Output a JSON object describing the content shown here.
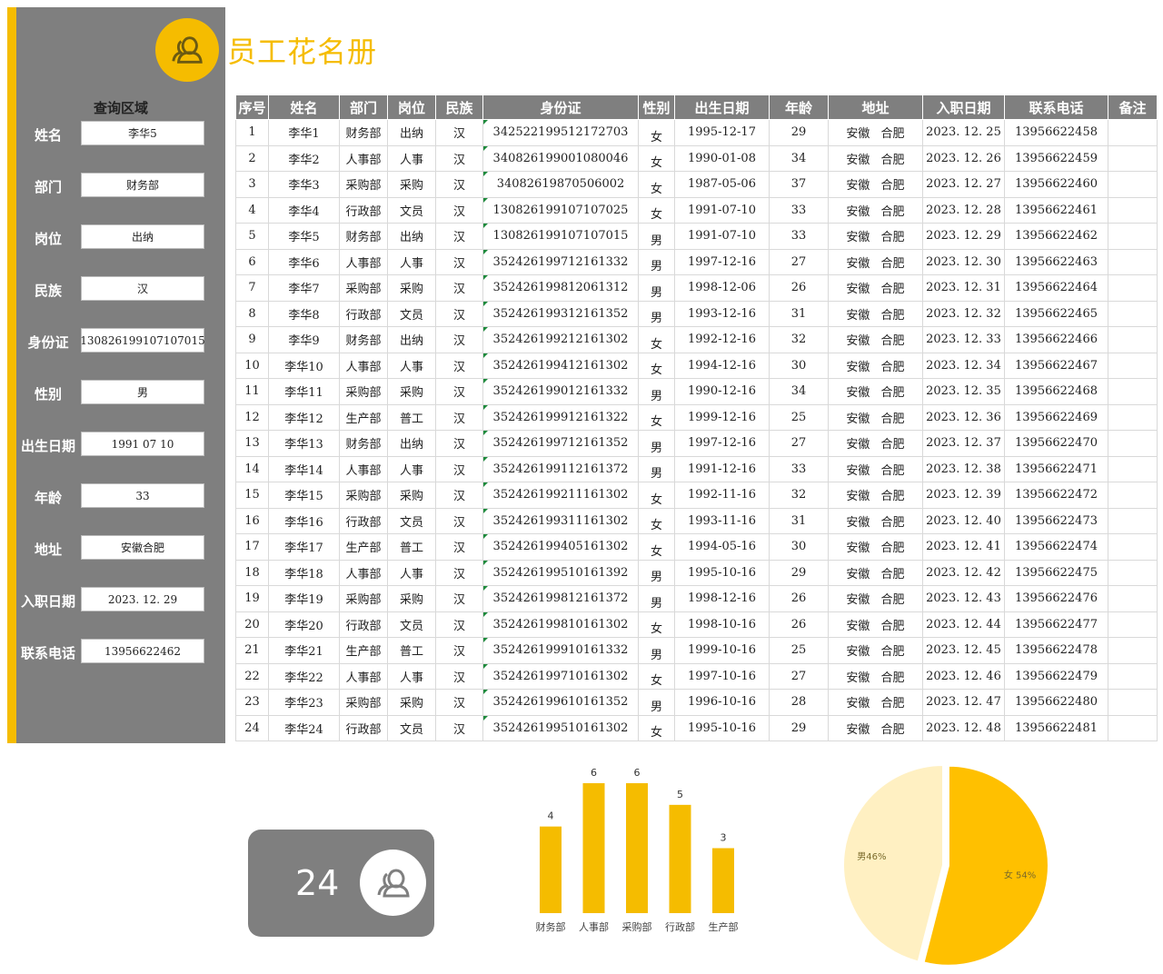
{
  "app": {
    "title": "员工花名册"
  },
  "query": {
    "title": "查询区域",
    "fields": [
      {
        "label": "姓名",
        "value": "李华5"
      },
      {
        "label": "部门",
        "value": "财务部"
      },
      {
        "label": "岗位",
        "value": "出纳"
      },
      {
        "label": "民族",
        "value": "汉"
      },
      {
        "label": "身份证",
        "value": "130826199107107015"
      },
      {
        "label": "性别",
        "value": "男"
      },
      {
        "label": "出生日期",
        "value": "1991  07  10"
      },
      {
        "label": "年龄",
        "value": "33"
      },
      {
        "label": "地址",
        "value": "安徽合肥"
      },
      {
        "label": "入职日期",
        "value": "2023. 12. 29"
      },
      {
        "label": "联系电话",
        "value": "13956622462"
      }
    ]
  },
  "table": {
    "columns": [
      "序号",
      "姓名",
      "部门",
      "岗位",
      "民族",
      "身份证",
      "性别",
      "出生日期",
      "年龄",
      "地址",
      "入职日期",
      "联系电话",
      "备注"
    ],
    "rows": [
      [
        "1",
        "李华1",
        "财务部",
        "出纳",
        "汉",
        "342522199512172703",
        "女",
        "1995-12-17",
        "29",
        "安徽 合肥",
        "2023. 12. 25",
        "13956622458",
        ""
      ],
      [
        "2",
        "李华2",
        "人事部",
        "人事",
        "汉",
        "340826199001080046",
        "女",
        "1990-01-08",
        "34",
        "安徽 合肥",
        "2023. 12. 26",
        "13956622459",
        ""
      ],
      [
        "3",
        "李华3",
        "采购部",
        "采购",
        "汉",
        "34082619870506002",
        "女",
        "1987-05-06",
        "37",
        "安徽 合肥",
        "2023. 12. 27",
        "13956622460",
        ""
      ],
      [
        "4",
        "李华4",
        "行政部",
        "文员",
        "汉",
        "130826199107107025",
        "女",
        "1991-07-10",
        "33",
        "安徽 合肥",
        "2023. 12. 28",
        "13956622461",
        ""
      ],
      [
        "5",
        "李华5",
        "财务部",
        "出纳",
        "汉",
        "130826199107107015",
        "男",
        "1991-07-10",
        "33",
        "安徽 合肥",
        "2023. 12. 29",
        "13956622462",
        ""
      ],
      [
        "6",
        "李华6",
        "人事部",
        "人事",
        "汉",
        "352426199712161332",
        "男",
        "1997-12-16",
        "27",
        "安徽 合肥",
        "2023. 12. 30",
        "13956622463",
        ""
      ],
      [
        "7",
        "李华7",
        "采购部",
        "采购",
        "汉",
        "352426199812061312",
        "男",
        "1998-12-06",
        "26",
        "安徽 合肥",
        "2023. 12. 31",
        "13956622464",
        ""
      ],
      [
        "8",
        "李华8",
        "行政部",
        "文员",
        "汉",
        "352426199312161352",
        "男",
        "1993-12-16",
        "31",
        "安徽 合肥",
        "2023. 12. 32",
        "13956622465",
        ""
      ],
      [
        "9",
        "李华9",
        "财务部",
        "出纳",
        "汉",
        "352426199212161302",
        "女",
        "1992-12-16",
        "32",
        "安徽 合肥",
        "2023. 12. 33",
        "13956622466",
        ""
      ],
      [
        "10",
        "李华10",
        "人事部",
        "人事",
        "汉",
        "352426199412161302",
        "女",
        "1994-12-16",
        "30",
        "安徽 合肥",
        "2023. 12. 34",
        "13956622467",
        ""
      ],
      [
        "11",
        "李华11",
        "采购部",
        "采购",
        "汉",
        "352426199012161332",
        "男",
        "1990-12-16",
        "34",
        "安徽 合肥",
        "2023. 12. 35",
        "13956622468",
        ""
      ],
      [
        "12",
        "李华12",
        "生产部",
        "普工",
        "汉",
        "352426199912161322",
        "女",
        "1999-12-16",
        "25",
        "安徽 合肥",
        "2023. 12. 36",
        "13956622469",
        ""
      ],
      [
        "13",
        "李华13",
        "财务部",
        "出纳",
        "汉",
        "352426199712161352",
        "男",
        "1997-12-16",
        "27",
        "安徽 合肥",
        "2023. 12. 37",
        "13956622470",
        ""
      ],
      [
        "14",
        "李华14",
        "人事部",
        "人事",
        "汉",
        "352426199112161372",
        "男",
        "1991-12-16",
        "33",
        "安徽 合肥",
        "2023. 12. 38",
        "13956622471",
        ""
      ],
      [
        "15",
        "李华15",
        "采购部",
        "采购",
        "汉",
        "352426199211161302",
        "女",
        "1992-11-16",
        "32",
        "安徽 合肥",
        "2023. 12. 39",
        "13956622472",
        ""
      ],
      [
        "16",
        "李华16",
        "行政部",
        "文员",
        "汉",
        "352426199311161302",
        "女",
        "1993-11-16",
        "31",
        "安徽 合肥",
        "2023. 12. 40",
        "13956622473",
        ""
      ],
      [
        "17",
        "李华17",
        "生产部",
        "普工",
        "汉",
        "352426199405161302",
        "女",
        "1994-05-16",
        "30",
        "安徽 合肥",
        "2023. 12. 41",
        "13956622474",
        ""
      ],
      [
        "18",
        "李华18",
        "人事部",
        "人事",
        "汉",
        "352426199510161392",
        "男",
        "1995-10-16",
        "29",
        "安徽 合肥",
        "2023. 12. 42",
        "13956622475",
        ""
      ],
      [
        "19",
        "李华19",
        "采购部",
        "采购",
        "汉",
        "352426199812161372",
        "男",
        "1998-12-16",
        "26",
        "安徽 合肥",
        "2023. 12. 43",
        "13956622476",
        ""
      ],
      [
        "20",
        "李华20",
        "行政部",
        "文员",
        "汉",
        "352426199810161302",
        "女",
        "1998-10-16",
        "26",
        "安徽 合肥",
        "2023. 12. 44",
        "13956622477",
        ""
      ],
      [
        "21",
        "李华21",
        "生产部",
        "普工",
        "汉",
        "352426199910161332",
        "男",
        "1999-10-16",
        "25",
        "安徽 合肥",
        "2023. 12. 45",
        "13956622478",
        ""
      ],
      [
        "22",
        "李华22",
        "人事部",
        "人事",
        "汉",
        "352426199710161302",
        "女",
        "1997-10-16",
        "27",
        "安徽 合肥",
        "2023. 12. 46",
        "13956622479",
        ""
      ],
      [
        "23",
        "李华23",
        "采购部",
        "采购",
        "汉",
        "352426199610161352",
        "男",
        "1996-10-16",
        "28",
        "安徽 合肥",
        "2023. 12. 47",
        "13956622480",
        ""
      ],
      [
        "24",
        "李华24",
        "行政部",
        "文员",
        "汉",
        "352426199510161302",
        "女",
        "1995-10-16",
        "29",
        "安徽 合肥",
        "2023. 12. 48",
        "13956622481",
        ""
      ]
    ]
  },
  "summary": {
    "total": "24"
  },
  "colors": {
    "accent": "#f5bc00",
    "panel": "#7f7f7f",
    "pie_male": "#fff0c2",
    "pie_female": "#ffc000"
  },
  "icons": {
    "title_avatar": "user-avatar-icon",
    "total_avatar": "user-avatar-icon"
  },
  "chart_data": [
    {
      "type": "bar",
      "title": "",
      "categories": [
        "财务部",
        "人事部",
        "采购部",
        "行政部",
        "生产部"
      ],
      "values": [
        4,
        6,
        6,
        5,
        3
      ],
      "ylim": [
        0,
        6
      ],
      "xlabel": "",
      "ylabel": "",
      "grid": false
    },
    {
      "type": "pie",
      "title": "",
      "categories": [
        "男",
        "女"
      ],
      "values": [
        46,
        54
      ],
      "labels": [
        "男46%",
        "女 54%"
      ]
    }
  ]
}
